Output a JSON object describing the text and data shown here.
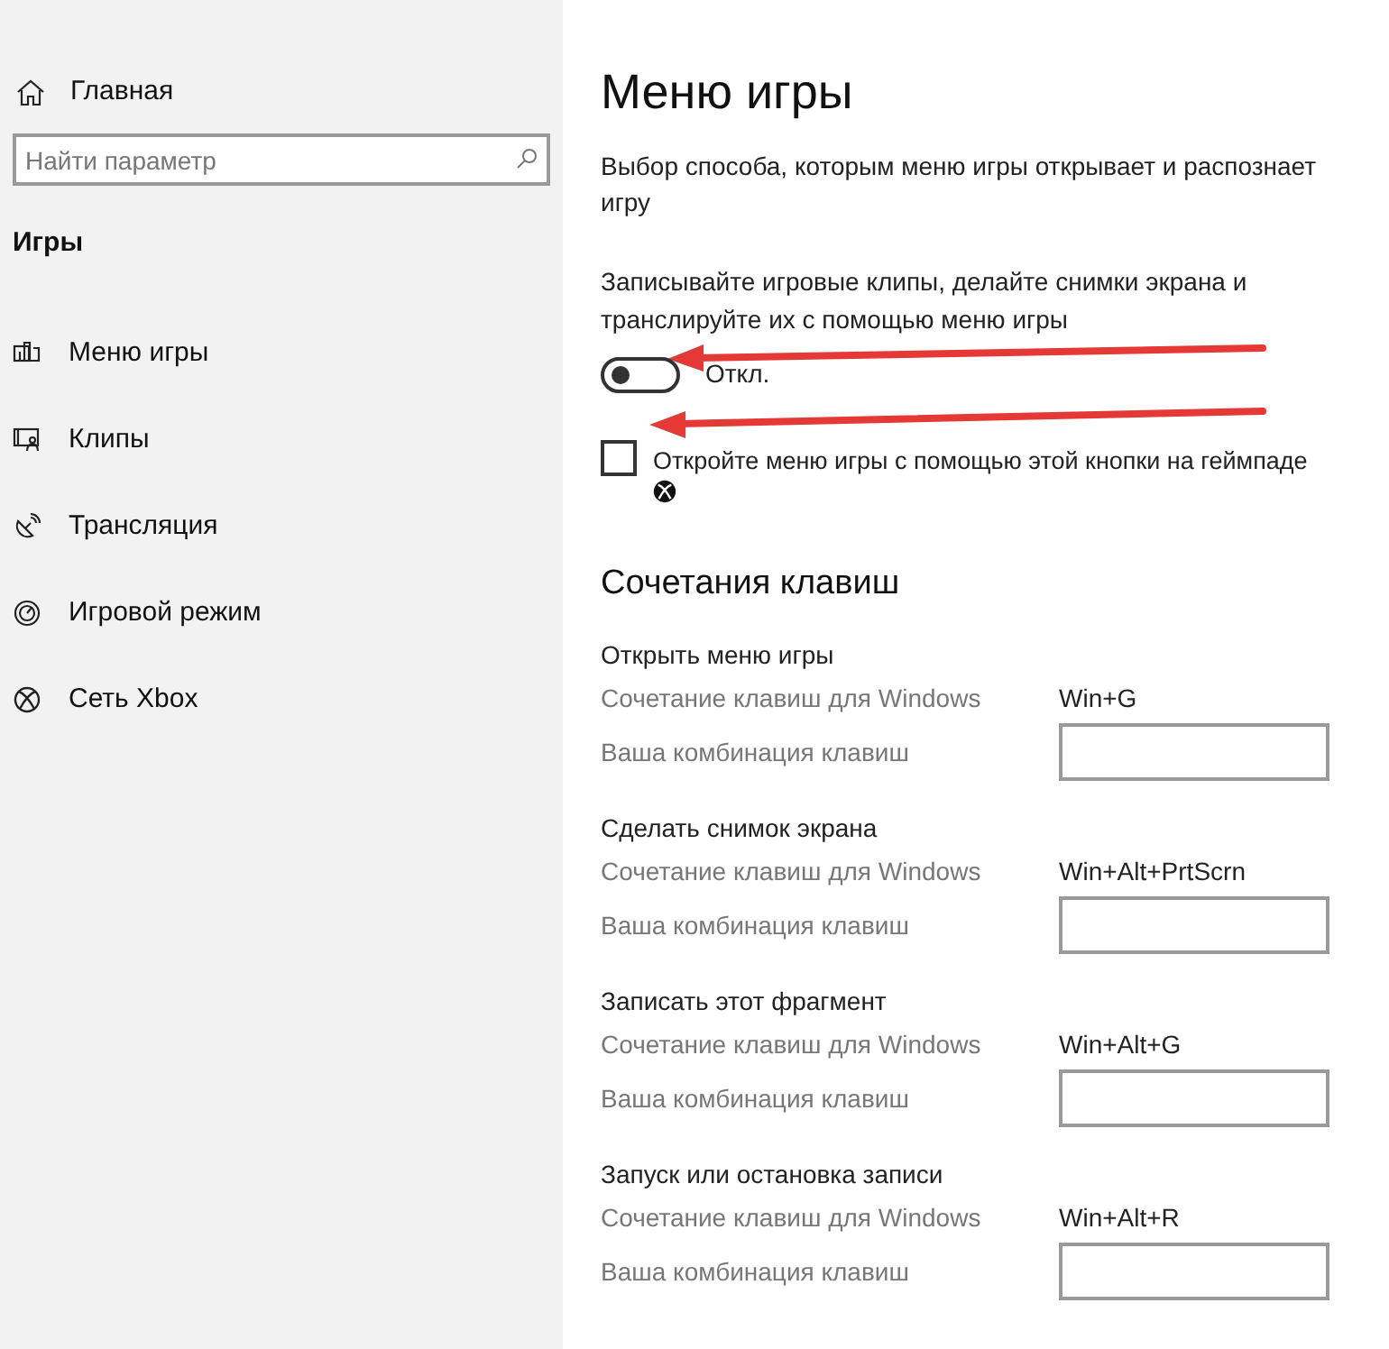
{
  "sidebar": {
    "home": "Главная",
    "search": {
      "placeholder": "Найти параметр"
    },
    "section": "Игры",
    "items": [
      {
        "label": "Меню игры"
      },
      {
        "label": "Клипы"
      },
      {
        "label": "Трансляция"
      },
      {
        "label": "Игровой режим"
      },
      {
        "label": "Сеть Xbox"
      }
    ]
  },
  "main": {
    "title": "Меню игры",
    "description": "Выбор способа, которым меню игры открывает и распознает игру",
    "toggle": {
      "caption": "Записывайте игровые клипы, делайте снимки экрана и транслируйте их с помощью меню игры",
      "on": false,
      "state_label": "Откл."
    },
    "checkbox": {
      "label": "Откройте меню игры с помощью этой кнопки на геймпаде",
      "checked": false
    },
    "shortcuts_title": "Сочетания клавиш",
    "shortcuts": [
      {
        "title": "Открыть меню игры",
        "windows_label": "Сочетание клавиш для Windows",
        "windows_value": "Win+G",
        "custom_label": "Ваша комбинация клавиш"
      },
      {
        "title": "Сделать снимок экрана",
        "windows_label": "Сочетание клавиш для Windows",
        "windows_value": "Win+Alt+PrtScrn",
        "custom_label": "Ваша комбинация клавиш"
      },
      {
        "title": "Записать этот фрагмент",
        "windows_label": "Сочетание клавиш для Windows",
        "windows_value": "Win+Alt+G",
        "custom_label": "Ваша комбинация клавиш"
      },
      {
        "title": "Запуск или остановка записи",
        "windows_label": "Сочетание клавиш для Windows",
        "windows_value": "Win+Alt+R",
        "custom_label": "Ваша комбинация клавиш"
      }
    ]
  }
}
